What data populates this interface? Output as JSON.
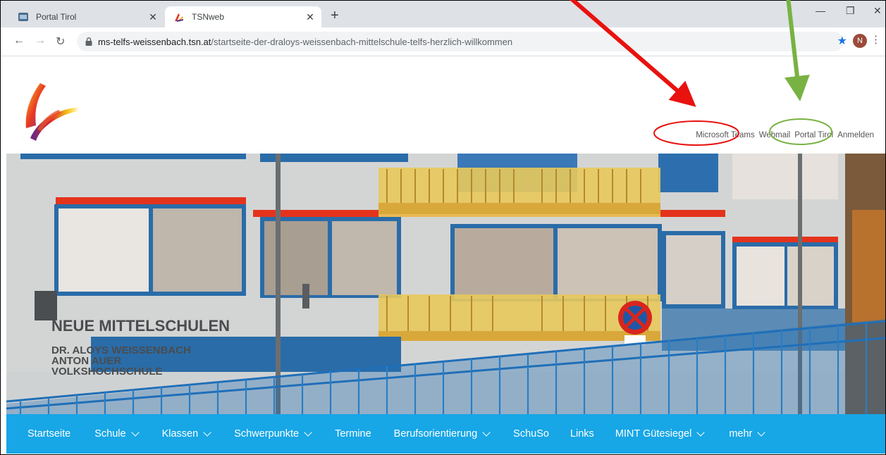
{
  "browser": {
    "tabs": [
      {
        "title": "Portal Tirol",
        "icon": "portal-tirol-favicon"
      },
      {
        "title": "TSNweb",
        "icon": "tsnweb-favicon",
        "active": true
      }
    ],
    "url_host": "ms-telfs-weissenbach.tsn.at",
    "url_path": "/startseite-der-draloys-weissenbach-mittelschule-telfs-herzlich-willkommen",
    "profile_initial": "N"
  },
  "header": {
    "links": [
      "Microsoft Teams",
      "Webmail",
      "Portal Tirol",
      "Anmelden"
    ]
  },
  "hero": {
    "sign_line1": "NEUE MITTELSCHULEN",
    "sign_line2": "DR. ALOYS WEISSENBACH",
    "sign_line3": "ANTON AUER",
    "sign_line4": "VOLKSHOCHSCHULE"
  },
  "nav": {
    "items": [
      {
        "label": "Startseite"
      },
      {
        "label": "Schule"
      },
      {
        "label": "Klassen"
      },
      {
        "label": "Schwerpunkte"
      },
      {
        "label": "Termine"
      },
      {
        "label": "Berufsorientierung"
      },
      {
        "label": "SchuSo"
      },
      {
        "label": "Links"
      },
      {
        "label": "MINT Gütesiegel"
      },
      {
        "label": "mehr"
      }
    ]
  },
  "colors": {
    "nav_bg": "#17a6e6",
    "annotation_red": "#e8120f",
    "annotation_green": "#78b243"
  }
}
